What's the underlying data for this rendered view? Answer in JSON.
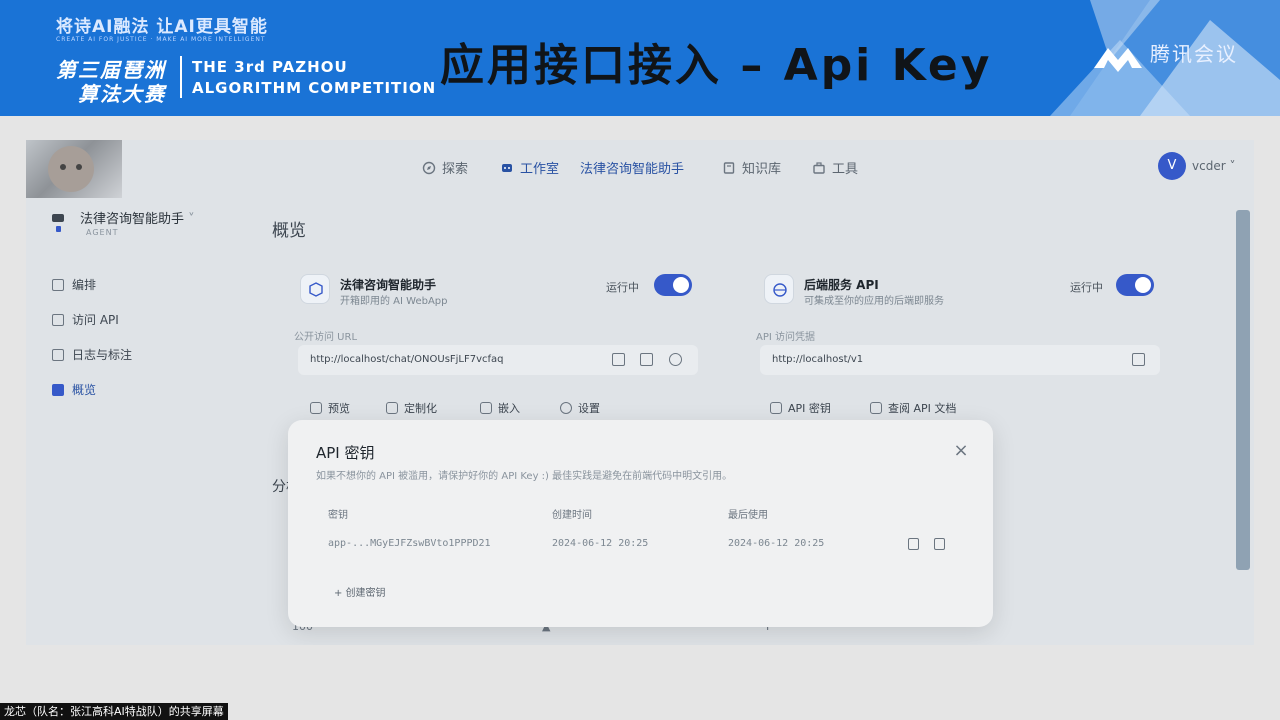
{
  "banner": {
    "slogan": "将诗AI融法 让AI更具智能",
    "slogan_en": "CREATE AI FOR JUSTICE · MAKE AI MORE INTELLIGENT",
    "competition_cn_1": "第三届琶洲",
    "competition_cn_2": "算法大赛",
    "competition_en_1": "THE 3rd PAZHOU",
    "competition_en_2": "ALGORITHM COMPETITION",
    "slide_title": "应用接口接入 – Api Key",
    "conference": "腾讯会议"
  },
  "topnav": {
    "explore": "探索",
    "studio": "工作室",
    "app": "法律咨询智能助手",
    "knowledge": "知识库",
    "tools": "工具",
    "avatar_letter": "V",
    "username": "vcder"
  },
  "app": {
    "name": "法律咨询智能助手",
    "tag": "AGENT"
  },
  "sidebar": {
    "items": [
      {
        "label": "编排"
      },
      {
        "label": "访问 API"
      },
      {
        "label": "日志与标注"
      },
      {
        "label": "概览"
      }
    ]
  },
  "page": {
    "title": "概览",
    "partial_left": "分析",
    "bottom_left": "100",
    "bottom_mid": "▲",
    "bottom_right": "I"
  },
  "webapp_card": {
    "title": "法律咨询智能助手",
    "subtitle": "开箱即用的 AI WebApp",
    "status": "运行中",
    "url_label": "公开访问 URL",
    "url": "http://localhost/chat/ONOUsFjLF7vcfaq",
    "actions": [
      "预览",
      "定制化",
      "嵌入",
      "设置"
    ]
  },
  "api_card": {
    "title": "后端服务 API",
    "subtitle": "可集成至你的应用的后端即服务",
    "status": "运行中",
    "url_label": "API 访问凭据",
    "url": "http://localhost/v1",
    "actions": [
      "API 密钥",
      "查阅 API 文档"
    ]
  },
  "modal": {
    "title": "API 密钥",
    "close": "×",
    "description": "如果不想你的 API 被滥用，请保护好你的 API Key :) 最佳实践是避免在前端代码中明文引用。",
    "columns": [
      "密钥",
      "创建时间",
      "最后使用"
    ],
    "rows": [
      {
        "key": "app-...MGyEJFZswBVto1PPPD21",
        "created": "2024-06-12 20:25",
        "last_used": "2024-06-12 20:25"
      }
    ],
    "create_label": "+ 创建密钥"
  },
  "caption": "龙芯（队名：张江高科AI特战队）的共享屏幕",
  "colors": {
    "banner_blue": "#1a73d6",
    "accent": "#3659c9",
    "modal_bg": "#f0f1f2"
  }
}
